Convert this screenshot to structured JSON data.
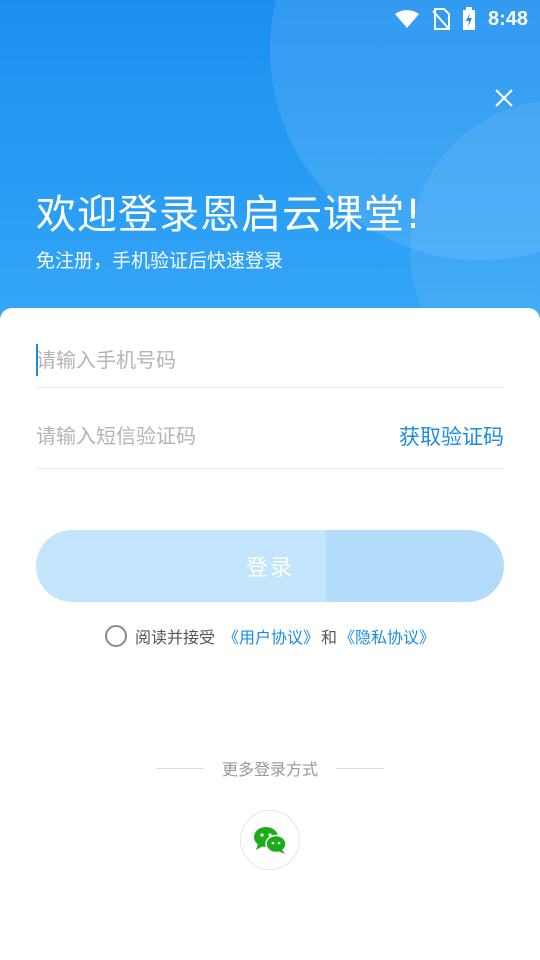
{
  "status_bar": {
    "time": "8:48",
    "icons": [
      "wifi-icon",
      "no-sim-icon",
      "battery-charging-icon"
    ]
  },
  "header": {
    "close_icon": "close-icon",
    "title": "欢迎登录恩启云课堂!",
    "subtitle": "免注册，手机验证后快速登录"
  },
  "form": {
    "phone_placeholder": "请输入手机号码",
    "phone_value": "",
    "code_placeholder": "请输入短信验证码",
    "code_value": "",
    "get_code_label": "获取验证码",
    "login_label": "登录"
  },
  "agreement": {
    "prefix": "阅读并接受",
    "user_agreement": "《用户协议》",
    "and": "和",
    "privacy_policy": "《隐私协议》",
    "checked": false
  },
  "more_login": {
    "label": "更多登录方式",
    "providers": [
      "wechat-icon"
    ]
  },
  "colors": {
    "primary": "#1a8ce6",
    "header_gradient_top": "#1b8ff0",
    "header_gradient_bottom": "#38a9f8",
    "login_button": "#c2e5fc",
    "wechat_green": "#1aad19"
  }
}
